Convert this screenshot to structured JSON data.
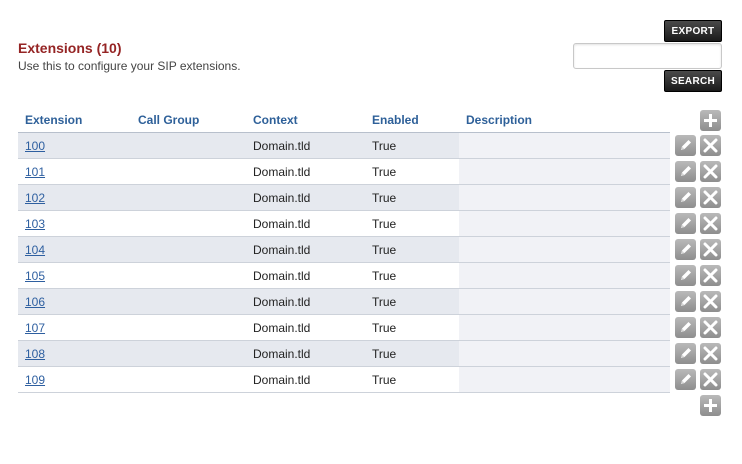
{
  "header": {
    "title": "Extensions (10)",
    "subtitle": "Use this to configure your SIP extensions."
  },
  "toolbar": {
    "export_label": "EXPORT",
    "search_label": "SEARCH",
    "search_value": ""
  },
  "table": {
    "columns": [
      "Extension",
      "Call Group",
      "Context",
      "Enabled",
      "Description"
    ],
    "rows": [
      {
        "extension": "100",
        "call_group": "",
        "context": "Domain.tld",
        "enabled": "True",
        "description": ""
      },
      {
        "extension": "101",
        "call_group": "",
        "context": "Domain.tld",
        "enabled": "True",
        "description": ""
      },
      {
        "extension": "102",
        "call_group": "",
        "context": "Domain.tld",
        "enabled": "True",
        "description": ""
      },
      {
        "extension": "103",
        "call_group": "",
        "context": "Domain.tld",
        "enabled": "True",
        "description": ""
      },
      {
        "extension": "104",
        "call_group": "",
        "context": "Domain.tld",
        "enabled": "True",
        "description": ""
      },
      {
        "extension": "105",
        "call_group": "",
        "context": "Domain.tld",
        "enabled": "True",
        "description": ""
      },
      {
        "extension": "106",
        "call_group": "",
        "context": "Domain.tld",
        "enabled": "True",
        "description": ""
      },
      {
        "extension": "107",
        "call_group": "",
        "context": "Domain.tld",
        "enabled": "True",
        "description": ""
      },
      {
        "extension": "108",
        "call_group": "",
        "context": "Domain.tld",
        "enabled": "True",
        "description": ""
      },
      {
        "extension": "109",
        "call_group": "",
        "context": "Domain.tld",
        "enabled": "True",
        "description": ""
      }
    ]
  },
  "icons": {
    "add": "plus-icon",
    "edit": "pencil-icon",
    "delete": "close-icon"
  },
  "colors": {
    "title": "#952424",
    "header_text": "#2e6099",
    "link": "#2e5fa0",
    "row_alt": "#e6e9ef",
    "icon_button": "#a3a3a3",
    "dark_button": "#1a1a1a"
  }
}
